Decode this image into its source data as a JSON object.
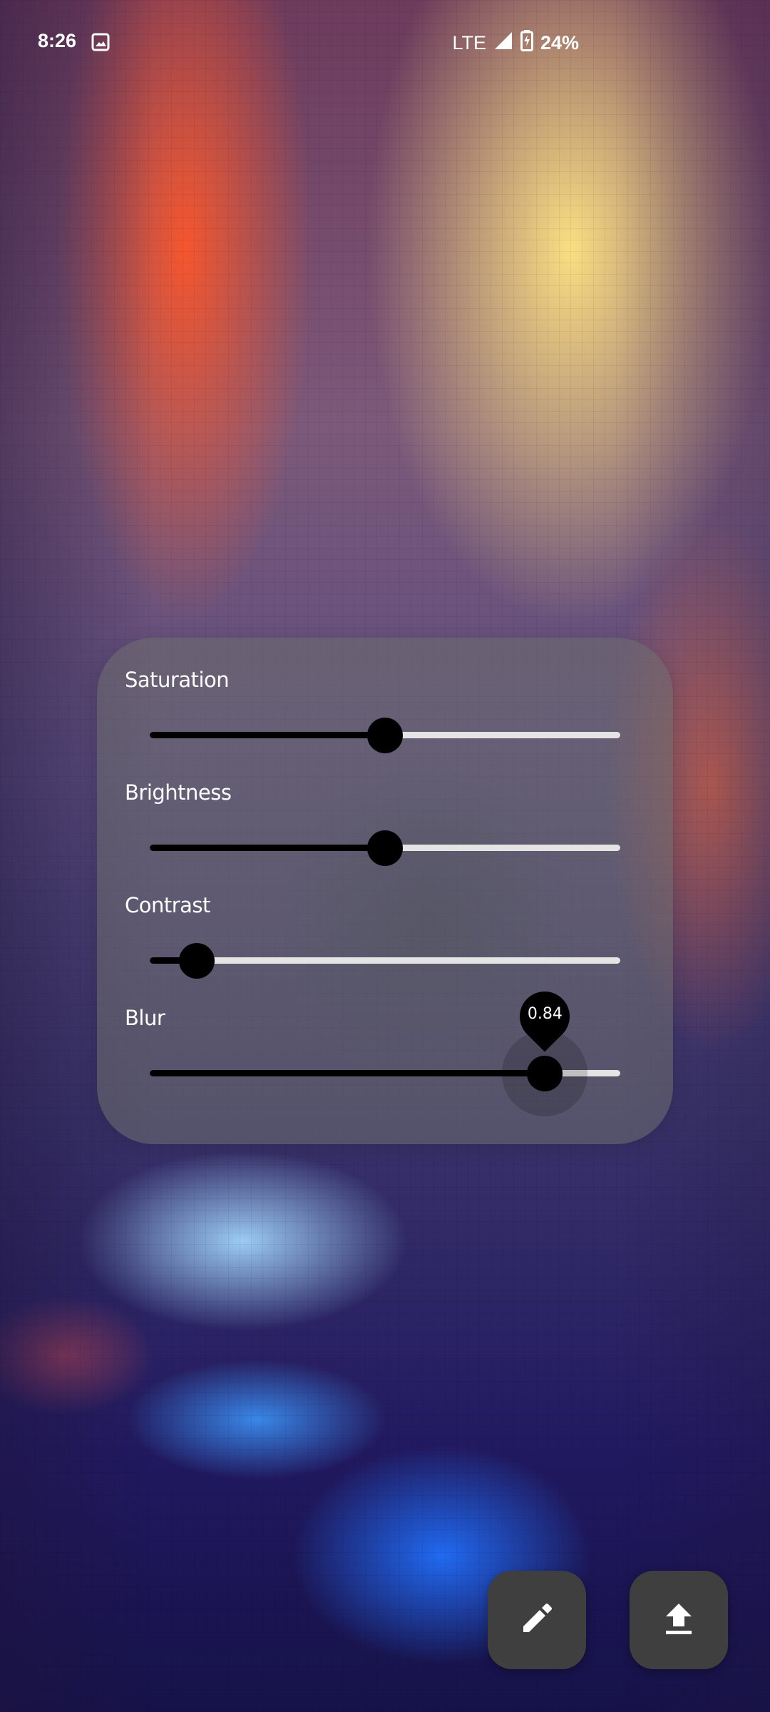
{
  "status_bar": {
    "time": "8:26",
    "network": "LTE",
    "battery": "24%",
    "icons": [
      "image-icon",
      "signal-icon",
      "battery-charging-icon"
    ]
  },
  "adjust_panel": {
    "sliders": [
      {
        "label": "Saturation",
        "value_fraction": 0.5
      },
      {
        "label": "Brightness",
        "value_fraction": 0.5
      },
      {
        "label": "Contrast",
        "value_fraction": 0.1
      },
      {
        "label": "Blur",
        "value_fraction": 0.84,
        "value_label": "0.84",
        "active": true
      }
    ]
  },
  "fabs": [
    {
      "name": "edit",
      "icon": "pencil-icon"
    },
    {
      "name": "upload",
      "icon": "upload-icon"
    }
  ],
  "colors": {
    "panel": "#6e6e6e",
    "track_inactive": "#e4e4e4",
    "track_active": "#000000",
    "fab": "#3f3f3f"
  }
}
